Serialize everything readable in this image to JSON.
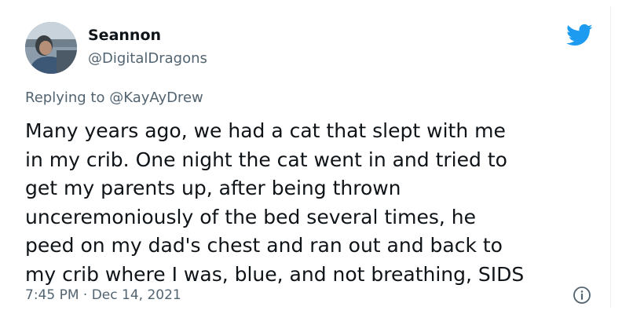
{
  "tweet": {
    "author": {
      "name": "Seannon",
      "handle": "@DigitalDragons"
    },
    "reply_prefix": "Replying to ",
    "reply_to": "@KayAyDrew",
    "text": "Many years ago, we had a cat that slept with me\nin my crib. One night the cat went in and tried to\nget my parents up, after being thrown\nunceremoniously of the bed several times, he\npeed on my dad's chest and ran out and back to\nmy crib where I was, blue, and not breathing, SIDS",
    "timestamp": "7:45 PM · Dec 14, 2021"
  },
  "icons": {
    "brand": "twitter-bird-icon",
    "info": "info-icon"
  },
  "colors": {
    "brand_blue": "#1d9bf0",
    "text_primary": "#0f1419",
    "text_secondary": "#536471"
  }
}
